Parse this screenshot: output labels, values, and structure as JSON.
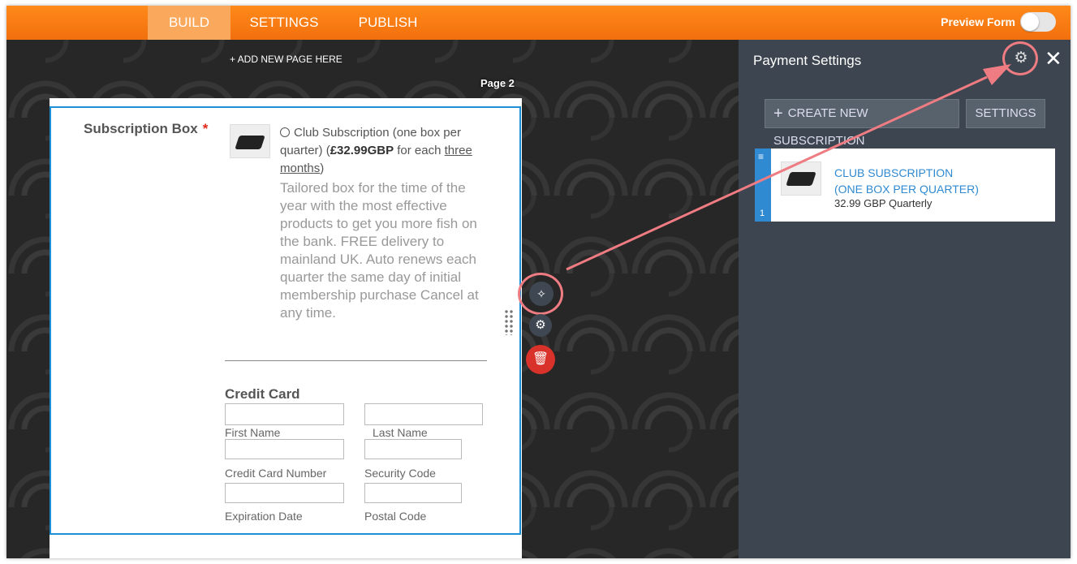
{
  "topbar": {
    "tabs": [
      {
        "label": "BUILD"
      },
      {
        "label": "SETTINGS"
      },
      {
        "label": "PUBLISH"
      }
    ],
    "preview_label": "Preview Form",
    "preview_on": false
  },
  "canvas": {
    "add_page": "+ ADD NEW PAGE HERE",
    "page_label": "Page 2",
    "field": {
      "label": "Subscription Box",
      "required_mark": "*",
      "option_pre": "Club Subscription (one box per quarter) (",
      "option_price": "£32.99GBP",
      "option_mid": " for each ",
      "option_period": "three months",
      "option_post": ")",
      "description": "Tailored box for the time of the year with the most effective products to get you more fish on the bank. FREE delivery to mainland UK. Auto renews each quarter the same day of initial membership purchase Cancel at any time."
    },
    "credit_card": {
      "title": "Credit Card",
      "first_name": "First Name",
      "last_name": "Last Name",
      "card_number": "Credit Card Number",
      "security_code": "Security Code",
      "expiration": "Expiration Date",
      "postal_code": "Postal Code"
    },
    "tools": {
      "wand_icon": "wand-icon",
      "gear_icon": "gear-icon",
      "trash_icon": "trash-icon"
    }
  },
  "panel": {
    "title": "Payment Settings",
    "create_button": "CREATE NEW SUBSCRIPTION",
    "settings_button": "SETTINGS",
    "subscription": {
      "index": "1",
      "name_line1": "CLUB SUBSCRIPTION",
      "name_line2": "(ONE BOX PER QUARTER)",
      "price": "32.99 GBP Quarterly"
    }
  },
  "colors": {
    "accent": "#f57c14",
    "panel": "#3d4650",
    "link": "#2f8ad1",
    "highlight": "#ef7c82",
    "required": "#e0281b"
  }
}
